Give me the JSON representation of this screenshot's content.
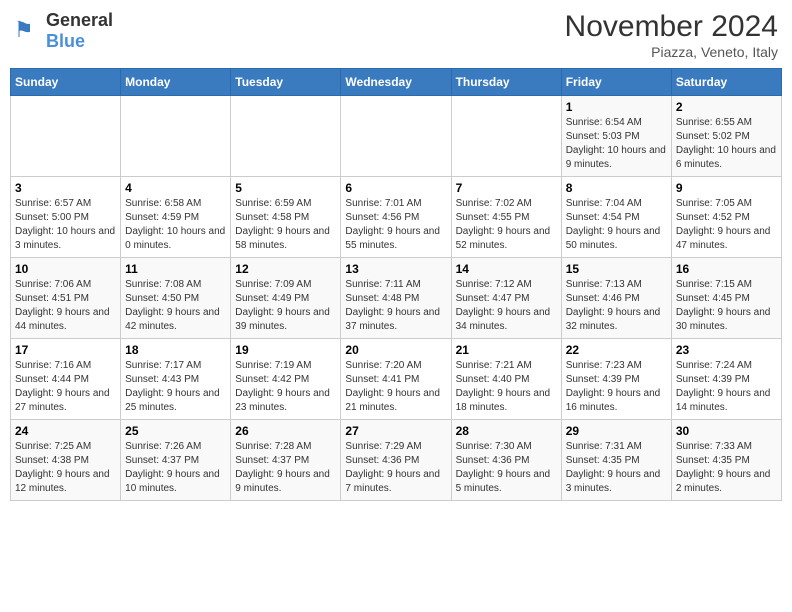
{
  "header": {
    "logo_general": "General",
    "logo_blue": "Blue",
    "title": "November 2024",
    "subtitle": "Piazza, Veneto, Italy"
  },
  "weekdays": [
    "Sunday",
    "Monday",
    "Tuesday",
    "Wednesday",
    "Thursday",
    "Friday",
    "Saturday"
  ],
  "weeks": [
    [
      {
        "day": "",
        "info": ""
      },
      {
        "day": "",
        "info": ""
      },
      {
        "day": "",
        "info": ""
      },
      {
        "day": "",
        "info": ""
      },
      {
        "day": "",
        "info": ""
      },
      {
        "day": "1",
        "info": "Sunrise: 6:54 AM\nSunset: 5:03 PM\nDaylight: 10 hours and 9 minutes."
      },
      {
        "day": "2",
        "info": "Sunrise: 6:55 AM\nSunset: 5:02 PM\nDaylight: 10 hours and 6 minutes."
      }
    ],
    [
      {
        "day": "3",
        "info": "Sunrise: 6:57 AM\nSunset: 5:00 PM\nDaylight: 10 hours and 3 minutes."
      },
      {
        "day": "4",
        "info": "Sunrise: 6:58 AM\nSunset: 4:59 PM\nDaylight: 10 hours and 0 minutes."
      },
      {
        "day": "5",
        "info": "Sunrise: 6:59 AM\nSunset: 4:58 PM\nDaylight: 9 hours and 58 minutes."
      },
      {
        "day": "6",
        "info": "Sunrise: 7:01 AM\nSunset: 4:56 PM\nDaylight: 9 hours and 55 minutes."
      },
      {
        "day": "7",
        "info": "Sunrise: 7:02 AM\nSunset: 4:55 PM\nDaylight: 9 hours and 52 minutes."
      },
      {
        "day": "8",
        "info": "Sunrise: 7:04 AM\nSunset: 4:54 PM\nDaylight: 9 hours and 50 minutes."
      },
      {
        "day": "9",
        "info": "Sunrise: 7:05 AM\nSunset: 4:52 PM\nDaylight: 9 hours and 47 minutes."
      }
    ],
    [
      {
        "day": "10",
        "info": "Sunrise: 7:06 AM\nSunset: 4:51 PM\nDaylight: 9 hours and 44 minutes."
      },
      {
        "day": "11",
        "info": "Sunrise: 7:08 AM\nSunset: 4:50 PM\nDaylight: 9 hours and 42 minutes."
      },
      {
        "day": "12",
        "info": "Sunrise: 7:09 AM\nSunset: 4:49 PM\nDaylight: 9 hours and 39 minutes."
      },
      {
        "day": "13",
        "info": "Sunrise: 7:11 AM\nSunset: 4:48 PM\nDaylight: 9 hours and 37 minutes."
      },
      {
        "day": "14",
        "info": "Sunrise: 7:12 AM\nSunset: 4:47 PM\nDaylight: 9 hours and 34 minutes."
      },
      {
        "day": "15",
        "info": "Sunrise: 7:13 AM\nSunset: 4:46 PM\nDaylight: 9 hours and 32 minutes."
      },
      {
        "day": "16",
        "info": "Sunrise: 7:15 AM\nSunset: 4:45 PM\nDaylight: 9 hours and 30 minutes."
      }
    ],
    [
      {
        "day": "17",
        "info": "Sunrise: 7:16 AM\nSunset: 4:44 PM\nDaylight: 9 hours and 27 minutes."
      },
      {
        "day": "18",
        "info": "Sunrise: 7:17 AM\nSunset: 4:43 PM\nDaylight: 9 hours and 25 minutes."
      },
      {
        "day": "19",
        "info": "Sunrise: 7:19 AM\nSunset: 4:42 PM\nDaylight: 9 hours and 23 minutes."
      },
      {
        "day": "20",
        "info": "Sunrise: 7:20 AM\nSunset: 4:41 PM\nDaylight: 9 hours and 21 minutes."
      },
      {
        "day": "21",
        "info": "Sunrise: 7:21 AM\nSunset: 4:40 PM\nDaylight: 9 hours and 18 minutes."
      },
      {
        "day": "22",
        "info": "Sunrise: 7:23 AM\nSunset: 4:39 PM\nDaylight: 9 hours and 16 minutes."
      },
      {
        "day": "23",
        "info": "Sunrise: 7:24 AM\nSunset: 4:39 PM\nDaylight: 9 hours and 14 minutes."
      }
    ],
    [
      {
        "day": "24",
        "info": "Sunrise: 7:25 AM\nSunset: 4:38 PM\nDaylight: 9 hours and 12 minutes."
      },
      {
        "day": "25",
        "info": "Sunrise: 7:26 AM\nSunset: 4:37 PM\nDaylight: 9 hours and 10 minutes."
      },
      {
        "day": "26",
        "info": "Sunrise: 7:28 AM\nSunset: 4:37 PM\nDaylight: 9 hours and 9 minutes."
      },
      {
        "day": "27",
        "info": "Sunrise: 7:29 AM\nSunset: 4:36 PM\nDaylight: 9 hours and 7 minutes."
      },
      {
        "day": "28",
        "info": "Sunrise: 7:30 AM\nSunset: 4:36 PM\nDaylight: 9 hours and 5 minutes."
      },
      {
        "day": "29",
        "info": "Sunrise: 7:31 AM\nSunset: 4:35 PM\nDaylight: 9 hours and 3 minutes."
      },
      {
        "day": "30",
        "info": "Sunrise: 7:33 AM\nSunset: 4:35 PM\nDaylight: 9 hours and 2 minutes."
      }
    ]
  ]
}
